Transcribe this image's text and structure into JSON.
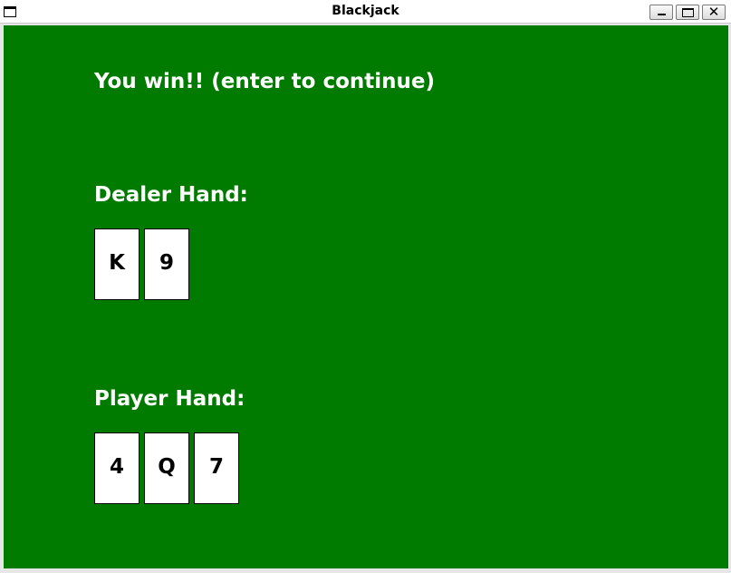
{
  "window": {
    "title": "Blackjack",
    "minimize_icon": "minimize-icon",
    "maximize_icon": "maximize-icon",
    "close_icon": "close-icon",
    "close_glyph": "✕"
  },
  "table_color": "#007b00",
  "status_message": "You win!! (enter to continue)",
  "dealer": {
    "label": "Dealer Hand:",
    "cards": [
      "K",
      "9"
    ]
  },
  "player": {
    "label": "Player Hand:",
    "cards": [
      "4",
      "Q",
      "7"
    ]
  }
}
